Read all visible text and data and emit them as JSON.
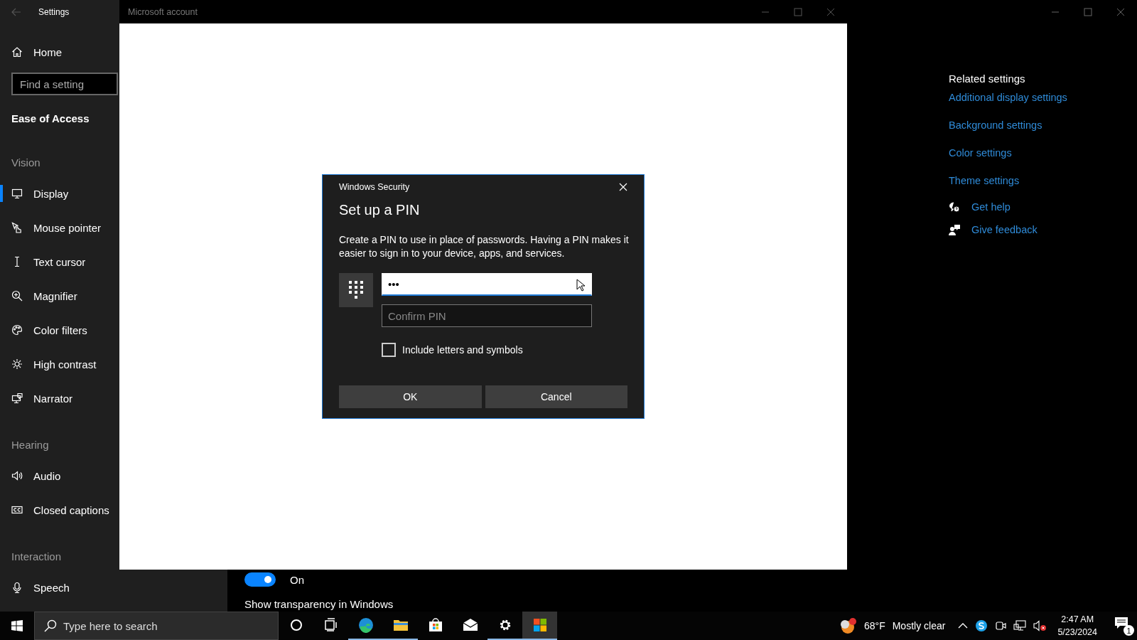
{
  "settings": {
    "title": "Settings",
    "home": {
      "label": "Home",
      "selected": false
    },
    "search": {
      "placeholder": "Find a setting"
    },
    "section": "Ease of Access",
    "groups": [
      {
        "heading": "Vision",
        "items": [
          {
            "label": "Display",
            "kind": "display",
            "selected": true
          },
          {
            "label": "Mouse pointer",
            "kind": "pointer",
            "selected": false
          },
          {
            "label": "Text cursor",
            "kind": "cursor",
            "selected": false
          },
          {
            "label": "Magnifier",
            "kind": "magnifier",
            "selected": false
          },
          {
            "label": "Color filters",
            "kind": "palette",
            "selected": false
          },
          {
            "label": "High contrast",
            "kind": "contrast",
            "selected": false
          },
          {
            "label": "Narrator",
            "kind": "narrator",
            "selected": false
          }
        ]
      },
      {
        "heading": "Hearing",
        "items": [
          {
            "label": "Audio",
            "kind": "audio",
            "selected": false
          },
          {
            "label": "Closed captions",
            "kind": "captions",
            "selected": false
          }
        ]
      },
      {
        "heading": "Interaction",
        "items": [
          {
            "label": "Speech",
            "kind": "speech",
            "selected": false
          }
        ]
      }
    ],
    "toggle": {
      "on": true,
      "label": "On"
    },
    "caption": "Show transparency in Windows",
    "related": {
      "heading": "Related settings",
      "links": [
        "Additional display settings",
        "Background settings",
        "Color settings",
        "Theme settings"
      ],
      "help": [
        {
          "label": "Get help",
          "kind": "help"
        },
        {
          "label": "Give feedback",
          "kind": "feedback"
        }
      ]
    }
  },
  "account_window": {
    "title": "Microsoft account"
  },
  "dialog": {
    "caption": "Windows Security",
    "title": "Set up a PIN",
    "description": "Create a PIN to use in place of passwords. Having a PIN makes it easier to sign in to your device, apps, and services.",
    "pin": {
      "value": "•••"
    },
    "confirm": {
      "placeholder": "Confirm PIN"
    },
    "checkbox": {
      "label": "Include letters and symbols",
      "checked": false
    },
    "buttons": [
      "OK",
      "Cancel"
    ]
  },
  "taskbar": {
    "search": {
      "placeholder": "Type here to search"
    },
    "apps": [
      {
        "kind": "cortana",
        "running": false,
        "selected": false
      },
      {
        "kind": "taskview",
        "running": false,
        "selected": false
      },
      {
        "kind": "edge",
        "running": true,
        "selected": false
      },
      {
        "kind": "explorer",
        "running": true,
        "selected": false
      },
      {
        "kind": "store",
        "running": false,
        "selected": false
      },
      {
        "kind": "mail",
        "running": false,
        "selected": false
      },
      {
        "kind": "settings",
        "running": true,
        "selected": false
      },
      {
        "kind": "tiles",
        "running": true,
        "selected": true
      }
    ],
    "weather": {
      "temperature": "68°F",
      "condition": "Mostly clear"
    },
    "clock": {
      "time": "2:47 AM",
      "date": "5/23/2024"
    },
    "notifications": {
      "count": "1"
    }
  }
}
